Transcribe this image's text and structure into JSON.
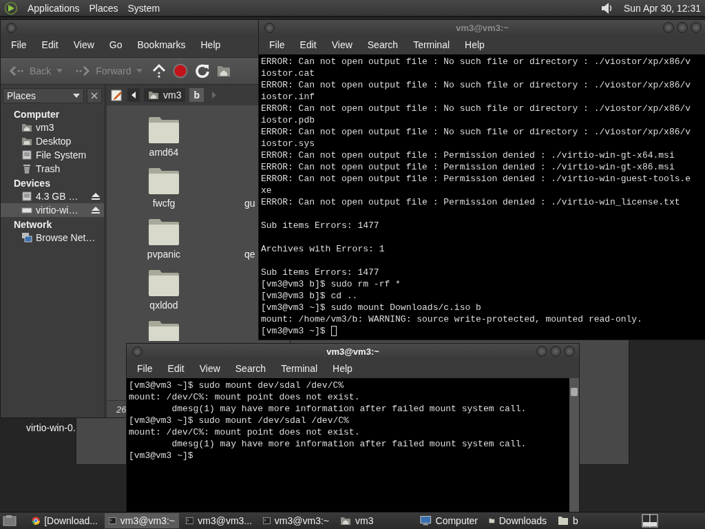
{
  "top_panel": {
    "menus": [
      "Applications",
      "Places",
      "System"
    ],
    "clock": "Sun Apr 30, 12:31"
  },
  "file_manager": {
    "menu": [
      "File",
      "Edit",
      "View",
      "Go",
      "Bookmarks",
      "Help"
    ],
    "nav_buttons": [
      {
        "label": "Back",
        "disabled": true
      },
      {
        "label": "Forward",
        "disabled": true
      }
    ],
    "side_pane": {
      "title": "Places",
      "sections": [
        {
          "heading": "Computer",
          "items": [
            {
              "label": "vm3",
              "kind": "home",
              "selected": false
            },
            {
              "label": "Desktop",
              "kind": "desktop",
              "selected": false
            },
            {
              "label": "File System",
              "kind": "drive",
              "selected": false
            },
            {
              "label": "Trash",
              "kind": "trash",
              "selected": false
            }
          ]
        },
        {
          "heading": "Devices",
          "items": [
            {
              "label": "4.3 GB …",
              "kind": "drive",
              "selected": false,
              "eject": true
            },
            {
              "label": "virtio-wi…",
              "kind": "disc",
              "selected": true,
              "eject": true
            }
          ]
        },
        {
          "heading": "Network",
          "items": [
            {
              "label": "Browse Net…",
              "kind": "network",
              "selected": false
            }
          ]
        }
      ]
    },
    "path": [
      {
        "label": "vm3",
        "kind": "home",
        "selected": false
      },
      {
        "label": "b",
        "kind": "folder",
        "selected": true
      }
    ],
    "rows": [
      {
        "items": [
          {
            "kind": "folder",
            "label": "amd64"
          }
        ]
      },
      {
        "items": [
          {
            "kind": "folder",
            "label": "fwcfg"
          },
          {
            "kind": "cut",
            "label": "gu"
          }
        ]
      },
      {
        "items": [
          {
            "kind": "folder",
            "label": "pvpanic"
          },
          {
            "kind": "cut",
            "label": "qe"
          }
        ]
      },
      {
        "items": [
          {
            "kind": "folder",
            "label": "qxldod"
          }
        ]
      },
      {
        "items": [
          {
            "kind": "folder"
          }
        ]
      }
    ],
    "status": "26"
  },
  "desktop_icons": [
    {
      "label": "virtio-win-0."
    }
  ],
  "terminals": [
    {
      "title": "vm3@vm3:~",
      "active": false,
      "menu": [
        "File",
        "Edit",
        "View",
        "Search",
        "Terminal",
        "Help"
      ],
      "cursor": true,
      "lines": [
        {
          "text": "ERROR: Can not open output file : No such file or directory : ./viostor/xp/x86/v"
        },
        {
          "text": "iostor.cat"
        },
        {
          "text": "ERROR: Can not open output file : No such file or directory : ./viostor/xp/x86/v"
        },
        {
          "text": "iostor.inf"
        },
        {
          "text": "ERROR: Can not open output file : No such file or directory : ./viostor/xp/x86/v"
        },
        {
          "text": "iostor.pdb"
        },
        {
          "text": "ERROR: Can not open output file : No such file or directory : ./viostor/xp/x86/v"
        },
        {
          "text": "iostor.sys"
        },
        {
          "text": "ERROR: Can not open output file : Permission denied : ./virtio-win-gt-x64.msi"
        },
        {
          "text": "ERROR: Can not open output file : Permission denied : ./virtio-win-gt-x86.msi"
        },
        {
          "text": "ERROR: Can not open output file : Permission denied : ./virtio-win-guest-tools.e"
        },
        {
          "text": "xe"
        },
        {
          "text": "ERROR: Can not open output file : Permission denied : ./virtio-win_license.txt"
        },
        {
          "text": "Sub items Errors: 1477",
          "blank_before": true
        },
        {
          "text": "Archives with Errors: 1",
          "blank_before": true
        },
        {
          "text": "Sub items Errors: 1477",
          "blank_before": true
        },
        {
          "text": "[vm3@vm3 b]$ sudo rm -rf *"
        },
        {
          "text": "[vm3@vm3 b]$ cd .."
        },
        {
          "text": "[vm3@vm3 ~]$ sudo mount Downloads/c.iso b"
        },
        {
          "text": "mount: /home/vm3/b: WARNING: source write-protected, mounted read-only."
        },
        {
          "text": "[vm3@vm3 ~]$"
        }
      ]
    },
    {
      "title": "vm3@vm3:~",
      "active": true,
      "menu": [
        "File",
        "Edit",
        "View",
        "Search",
        "Terminal",
        "Help"
      ],
      "scrollbar": true,
      "lines": [
        {
          "text": "[vm3@vm3 ~]$ sudo mount dev/sdal /dev/C%"
        },
        {
          "text": "mount: /dev/C%: mount point does not exist."
        },
        {
          "text": "        dmesg(1) may have more information after failed mount system call."
        },
        {
          "text": "[vm3@vm3 ~]$ sudo mount /dev/sdal /dev/C%"
        },
        {
          "text": "mount: /dev/C%: mount point does not exist."
        },
        {
          "text": "        dmesg(1) may have more information after failed mount system call."
        },
        {
          "text": "[vm3@vm3 ~]$"
        }
      ]
    }
  ],
  "taskbar": {
    "items": [
      {
        "label": "[Download...",
        "kind": "browser",
        "selected": false
      },
      {
        "label": "vm3@vm3:~",
        "kind": "terminal",
        "selected": true
      },
      {
        "label": "vm3@vm3...",
        "kind": "terminal",
        "selected": false
      },
      {
        "label": "vm3@vm3:~",
        "kind": "terminal",
        "selected": false
      },
      {
        "label": "vm3",
        "kind": "home",
        "selected": false
      },
      {
        "label": "Computer",
        "kind": "computer",
        "selected": false
      },
      {
        "label": "Downloads",
        "kind": "folder",
        "selected": false
      },
      {
        "label": "b",
        "kind": "folder",
        "selected": false
      }
    ]
  }
}
